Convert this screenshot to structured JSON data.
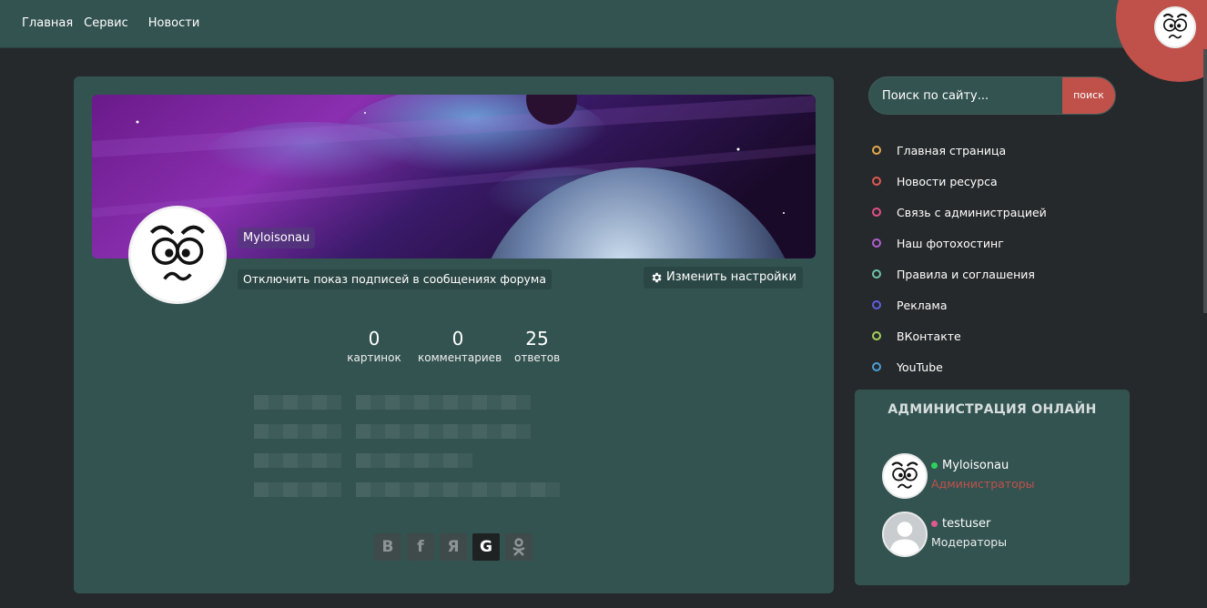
{
  "nav": {
    "items": [
      "Главная",
      "Сервис",
      "Новости"
    ]
  },
  "profile": {
    "username": "Myloisonau",
    "signature_toggle": "Отключить показ подписей в сообщениях форума",
    "settings_button": "Изменить настройки",
    "stats": [
      {
        "value": "0",
        "label": "картинок"
      },
      {
        "value": "0",
        "label": "комментариев"
      },
      {
        "value": "25",
        "label": "ответов"
      }
    ]
  },
  "socials": [
    {
      "icon": "vk-icon",
      "glyph": "В",
      "active": false
    },
    {
      "icon": "facebook-icon",
      "glyph": "f",
      "active": false
    },
    {
      "icon": "yandex-icon",
      "glyph": "Я",
      "active": false
    },
    {
      "icon": "google-icon",
      "glyph": "G",
      "active": true
    },
    {
      "icon": "odnoklassniki-icon",
      "glyph": "ok",
      "active": false
    }
  ],
  "search": {
    "placeholder": "Поиск по сайту...",
    "button": "поиск"
  },
  "menu": [
    {
      "label": "Главная страница",
      "color": "#e6a94a"
    },
    {
      "label": "Новости ресурса",
      "color": "#e05a52"
    },
    {
      "label": "Связь с администрацией",
      "color": "#e0508a"
    },
    {
      "label": "Наш фотохостинг",
      "color": "#b060d0"
    },
    {
      "label": "Правила и соглашения",
      "color": "#6fc2a8"
    },
    {
      "label": "Реклама",
      "color": "#5f5fe0"
    },
    {
      "label": "ВКонтакте",
      "color": "#a6cf5a"
    },
    {
      "label": "YouTube",
      "color": "#4a9fd6"
    }
  ],
  "admin_panel": {
    "title": "АДМИНИСТРАЦИЯ ОНЛАЙН",
    "members": [
      {
        "name": "Myloisonau",
        "group": "Администраторы",
        "status_color": "#2fd15a",
        "group_color": "#c0504a"
      },
      {
        "name": "testuser",
        "group": "Модераторы",
        "status_color": "#e05a8a",
        "group_color": "#e8ecec"
      }
    ]
  },
  "colors": {
    "accent": "#c0504a",
    "panel": "#335351",
    "background": "#26292b"
  }
}
